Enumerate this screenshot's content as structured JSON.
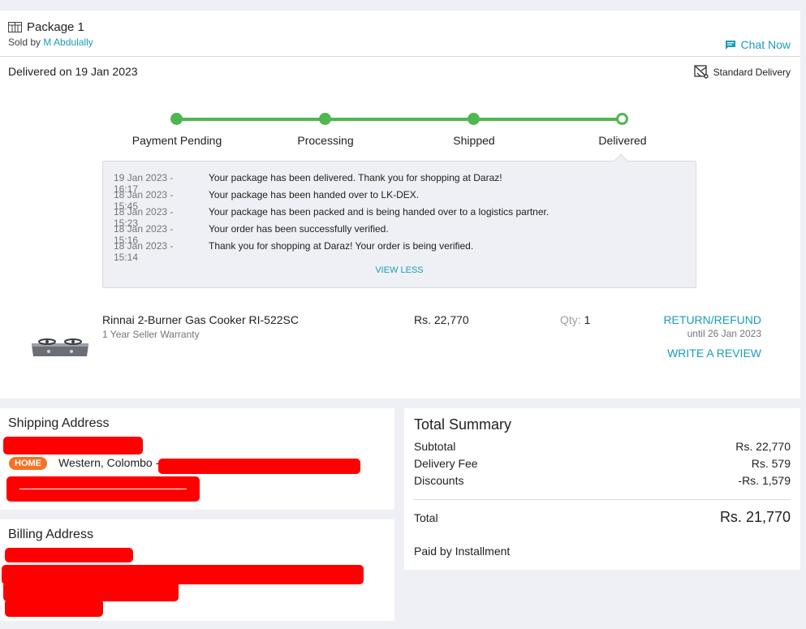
{
  "package": {
    "title": "Package 1",
    "sold_by_prefix": "Sold by",
    "seller": "M Abdulally",
    "chat_label": "Chat Now",
    "delivered_on": "Delivered on 19 Jan 2023",
    "delivery_type": "Standard Delivery"
  },
  "progress": {
    "steps": [
      "Payment Pending",
      "Processing",
      "Shipped",
      "Delivered"
    ],
    "current_step": 4
  },
  "tracking_log": {
    "entries": [
      {
        "time": "19 Jan 2023 - 16:17",
        "message": "Your package has been delivered. Thank you for shopping at Daraz!"
      },
      {
        "time": "18 Jan 2023 - 15:45",
        "message": "Your package has been handed over to LK-DEX."
      },
      {
        "time": "18 Jan 2023 - 15:23",
        "message": "Your package has been packed and is being handed over to a logistics partner."
      },
      {
        "time": "18 Jan 2023 - 15:16",
        "message": "Your order has been successfully verified."
      },
      {
        "time": "18 Jan 2023 - 15:14",
        "message": "Thank you for shopping at Daraz! Your order is being verified."
      }
    ],
    "toggle_label": "VIEW LESS"
  },
  "item": {
    "name": "Rinnai 2-Burner Gas Cooker RI-522SC",
    "warranty": "1 Year Seller Warranty",
    "price": "Rs. 22,770",
    "qty_label": "Qty:",
    "qty": "1",
    "return_label": "RETURN/REFUND",
    "return_until": "until 26 Jan 2023",
    "review_label": "WRITE A REVIEW"
  },
  "shipping": {
    "title": "Shipping Address",
    "badge": "HOME",
    "line": "Western, Colombo -"
  },
  "billing": {
    "title": "Billing Address"
  },
  "summary": {
    "title": "Total Summary",
    "subtotal_label": "Subtotal",
    "subtotal": "Rs. 22,770",
    "delivery_label": "Delivery Fee",
    "delivery": "Rs. 579",
    "discounts_label": "Discounts",
    "discounts": "-Rs. 1,579",
    "total_label": "Total",
    "total": "Rs. 21,770",
    "payment": "Paid by Installment"
  },
  "colors": {
    "accent": "#1a9cb7",
    "progress": "#4fb74f",
    "badge": "#f57224",
    "redaction": "#ff0000"
  }
}
